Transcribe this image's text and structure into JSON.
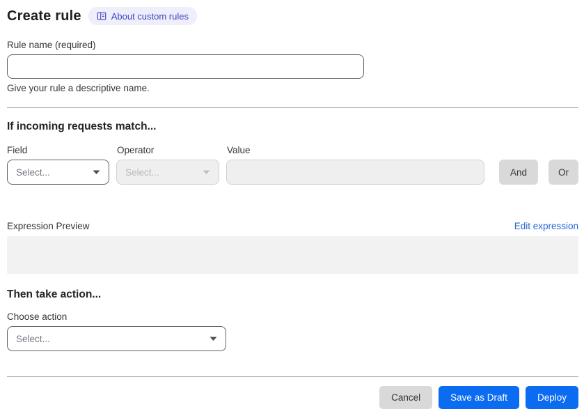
{
  "page": {
    "title": "Create rule",
    "about_badge_label": "About custom rules"
  },
  "rule_name": {
    "label": "Rule name (required)",
    "value": "",
    "helper": "Give your rule a descriptive name."
  },
  "match_section": {
    "heading": "If incoming requests match...",
    "field": {
      "label": "Field",
      "selected": "Select..."
    },
    "operator": {
      "label": "Operator",
      "selected": "Select..."
    },
    "value": {
      "label": "Value",
      "value": ""
    },
    "and_button_label": "And",
    "or_button_label": "Or"
  },
  "expression": {
    "label": "Expression Preview",
    "edit_link_label": "Edit expression",
    "preview_content": ""
  },
  "action_section": {
    "heading": "Then take action...",
    "choose_label": "Choose action",
    "selected": "Select..."
  },
  "footer": {
    "cancel_label": "Cancel",
    "save_draft_label": "Save as Draft",
    "deploy_label": "Deploy"
  },
  "icons": {
    "about_badge_icon": "book-icon",
    "select_caret": "chevron-down-icon"
  },
  "colors": {
    "primary_blue": "#0b6cf2",
    "link_blue": "#2566d6",
    "badge_bg": "#eeeffb",
    "badge_text": "#3e45c2",
    "gray_button": "#d9d9d9",
    "disabled_bg": "#efefef",
    "divider": "#b0b0b0"
  }
}
